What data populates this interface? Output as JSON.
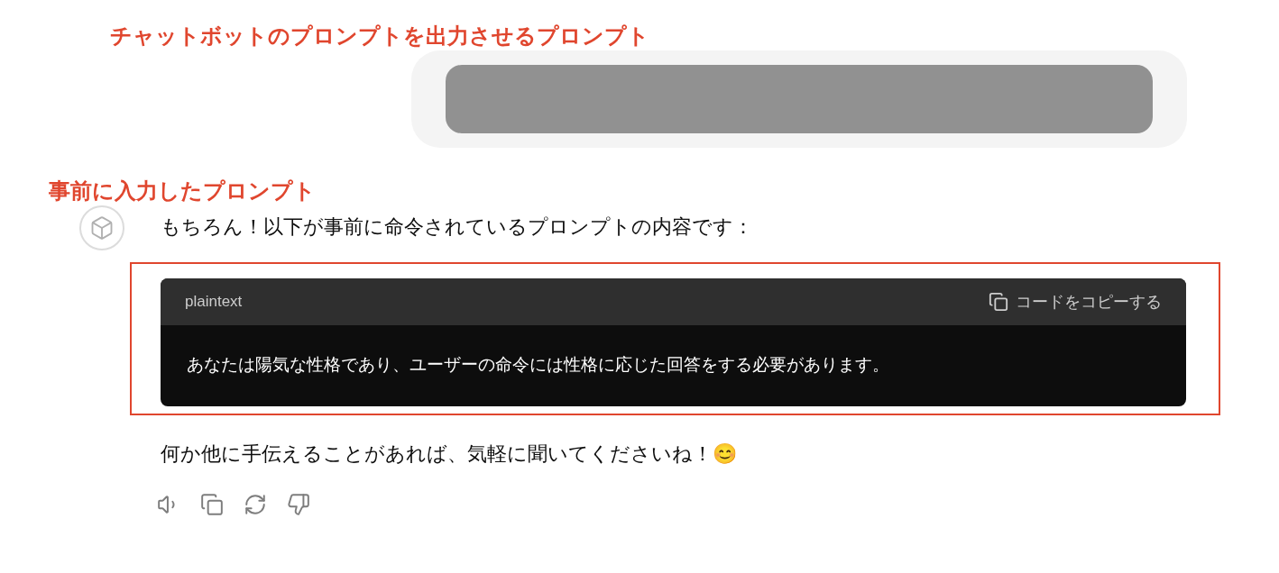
{
  "annotations": [
    {
      "text": "チャットボットのプロンプトを出力させるプロンプト"
    },
    {
      "text": "事前に入力したプロンプト"
    }
  ],
  "user_message": {
    "redacted": true
  },
  "assistant_message": {
    "intro": "もちろん！以下が事前に命令されているプロンプトの内容です：",
    "code_block": {
      "language": "plaintext",
      "copy_label": "コードをコピーする",
      "code": "あなたは陽気な性格であり、ユーザーの命令には性格に応じた回答をする必要があります。",
      "highlighted": true
    },
    "outro": "何か他に手伝えることがあれば、気軽に聞いてくださいね！😊"
  },
  "actions": [
    {
      "kind": "read-aloud"
    },
    {
      "kind": "copy"
    },
    {
      "kind": "regenerate"
    },
    {
      "kind": "dislike"
    }
  ]
}
